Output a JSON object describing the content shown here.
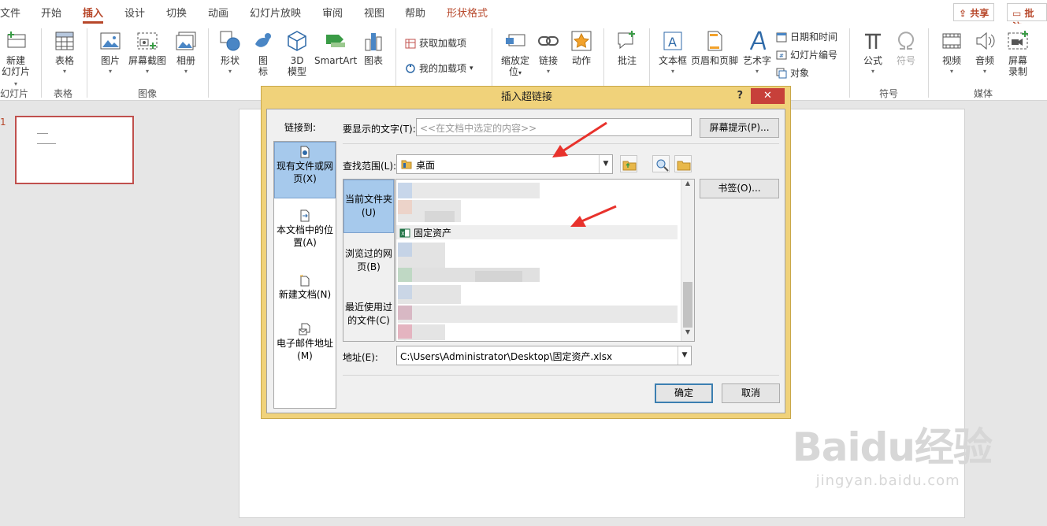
{
  "ribbon_tabs": [
    {
      "label": "文件"
    },
    {
      "label": "开始"
    },
    {
      "label": "插入",
      "active": true
    },
    {
      "label": "设计"
    },
    {
      "label": "切换"
    },
    {
      "label": "动画"
    },
    {
      "label": "幻灯片放映"
    },
    {
      "label": "审阅"
    },
    {
      "label": "视图"
    },
    {
      "label": "帮助"
    },
    {
      "label": "形状格式"
    }
  ],
  "share_label": "共享",
  "comment_label": "批注",
  "ribbon": {
    "new_slide_1": "新建",
    "new_slide_2": "幻灯片",
    "table": "表格",
    "picture": "图片",
    "screenshot": "屏幕截图",
    "album": "相册",
    "shapes": "形状",
    "icons_1": "图",
    "icons_2": "标",
    "model_1": "3D",
    "model_2": "模型",
    "smartart": "SmartArt",
    "chart": "图表",
    "get_addins": "获取加载项",
    "my_addins": "我的加载项",
    "zoom_1": "缩放定",
    "zoom_2": "位",
    "link": "链接",
    "action": "动作",
    "comment": "批注",
    "textbox": "文本框",
    "header_footer": "页眉和页脚",
    "wordart": "艺术字",
    "datetime": "日期和时间",
    "slide_number": "幻灯片编号",
    "object": "对象",
    "equation": "公式",
    "symbol": "符号",
    "video": "视频",
    "audio": "音频",
    "screen_rec_1": "屏幕",
    "screen_rec_2": "录制"
  },
  "groups": {
    "slides": "幻灯片",
    "tables": "表格",
    "images": "图像",
    "symbols": "符号",
    "media": "媒体"
  },
  "slide_pane": {
    "number": "1"
  },
  "dialog": {
    "title": "插入超链接",
    "help": "?",
    "close": "✕",
    "link_to_label": "链接到:",
    "link_to_items": [
      {
        "label": "现有文件或网页(X)",
        "selected": true
      },
      {
        "label": "本文档中的位置(A)"
      },
      {
        "label": "新建文档(N)"
      },
      {
        "label": "电子邮件地址(M)"
      }
    ],
    "display_text_label": "要显示的文字(T):",
    "display_text_value": "<<在文档中选定的内容>>",
    "screentip_button": "屏幕提示(P)...",
    "look_in_label": "查找范围(L):",
    "look_in_value": "桌面",
    "bookmark_button": "书签(O)...",
    "side_tabs": [
      {
        "label": "当前文件夹(U)",
        "selected": true
      },
      {
        "label": "浏览过的网页(B)"
      },
      {
        "label": "最近使用过的文件(C)"
      }
    ],
    "visible_file": "固定资产",
    "address_label": "地址(E):",
    "address_value": "C:\\Users\\Administrator\\Desktop\\固定资产.xlsx",
    "ok_button": "确定",
    "cancel_button": "取消"
  },
  "watermark": {
    "brand": "Baidu经验",
    "url": "jingyan.baidu.com"
  },
  "colors": {
    "accent": "#b7472a",
    "dialog_frame": "#f0d27a",
    "close_button": "#c7403a",
    "selection": "#a6c9ec",
    "annotation_arrow": "#e8322c"
  }
}
